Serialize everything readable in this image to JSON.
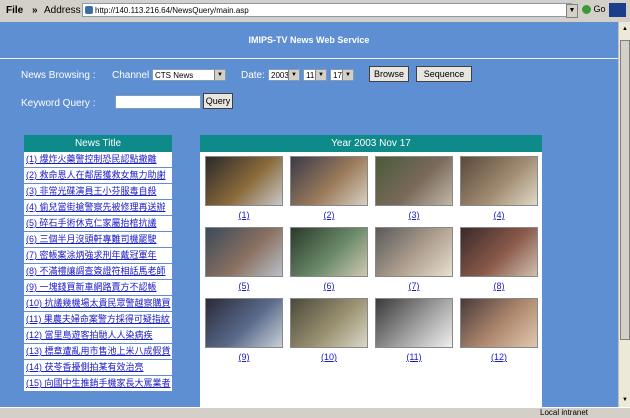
{
  "browser": {
    "file_menu": "File",
    "chevron": "»",
    "address_label": "Address",
    "url": "http://140.113.216.64/NewsQuery/main.asp",
    "go_label": "Go",
    "status_zone": "Local intranet"
  },
  "page": {
    "title": "IMIPS-TV News Web Service",
    "browsing_label": "News Browsing :",
    "channel_label": "Channel",
    "channel_value": "CTS News",
    "date_label": "Date:",
    "year_value": "2003",
    "month_value": "11",
    "day_value": "17",
    "browse_button": "Browse",
    "sequence_button": "Sequence",
    "keyword_label": "Keyword Query :",
    "keyword_value": "",
    "query_button": "Query"
  },
  "news_list": {
    "header": "News Title",
    "items": [
      "(1) 爆炸火藥警控制恐民認點撤離",
      "(2) 救命恩人在鄰居獲救女無力助謝",
      "(3) 非常光碟演員王小芬服毒自殺",
      "(4) 偷兒當街搶警察先被修理再送辦",
      "(5) 碎石手術休克仁家屬抬棺抗議",
      "(6) 三個半月沒頭軒專難司機罷駛",
      "(7) 密帳案涂炳強求刑年戴冠軍年",
      "(8) 不滿禮讓調查簽證符相話馬老師",
      "(9) 一塊錢買新車網路賣方不認帳",
      "(10) 抗議幾機場太貴民眾警越察購買",
      "(11) 果農夫婦命案警方採得可疑指紋",
      "(12) 當里島遊客拍馳人人染病疾",
      "(13) 標章遭亂用市售池上米八成假貨",
      "(14) 茯苓香擾側拍某有效治亮",
      "(15) 向國中生推銷手機家長大罵業者"
    ]
  },
  "grid": {
    "header": "Year 2003 Nov 17",
    "items": [
      "(1)",
      "(2)",
      "(3)",
      "(4)",
      "(5)",
      "(6)",
      "(7)",
      "(8)",
      "(9)",
      "(10)",
      "(11)",
      "(12)"
    ]
  },
  "colors": {
    "page_bg": "#5f8fd3",
    "header_teal": "#0f8a8a",
    "link_blue": "#1919c8"
  }
}
